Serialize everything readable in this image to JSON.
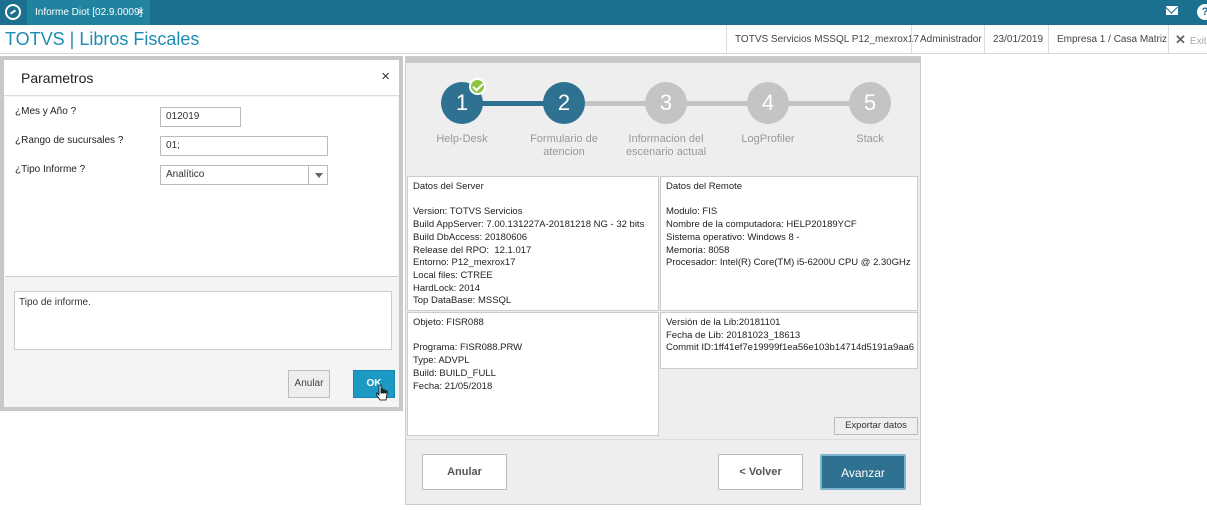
{
  "topbar": {
    "tab_label": "Informe Diot [02.9.0009]",
    "tab_close": "×",
    "icons": [
      "logo-icon",
      "mail-icon",
      "help-icon"
    ]
  },
  "header": {
    "title": "TOTVS | Libros Fiscales",
    "environment": "TOTVS Servicios MSSQL P12_mexrox17",
    "user": "Administrador",
    "date": "23/01/2019",
    "company": "Empresa 1 / Casa Matriz",
    "exit_label": "Exit"
  },
  "dialog": {
    "title": "Parametros",
    "close": "×",
    "fields": [
      {
        "label": "¿Mes y Año ?",
        "value": "012019"
      },
      {
        "label": "¿Rango de sucursales ?",
        "value": "01;"
      },
      {
        "label": "¿Tipo Informe ?",
        "value": "Analítico"
      }
    ],
    "help_text": "Tipo de informe.",
    "cancel_label": "Anular",
    "ok_label": "OK"
  },
  "wizard": {
    "steps": [
      {
        "number": "1",
        "label": "Help-Desk",
        "state": "complete"
      },
      {
        "number": "2",
        "label": "Formulario de atencion",
        "state": "active"
      },
      {
        "number": "3",
        "label": "Informacion del escenario actual",
        "state": "pending"
      },
      {
        "number": "4",
        "label": "LogProfiler",
        "state": "pending"
      },
      {
        "number": "5",
        "label": "Stack",
        "state": "pending"
      }
    ],
    "server_panel": "Datos del Server\n\nVersion: TOTVS Servicios\nBuild AppServer: 7.00.131227A-20181218 NG - 32 bits\nBuild DbAccess: 20180606\nRelease del RPO:  12.1.017\nEntorno: P12_mexrox17\nLocal files: CTREE\nHardLock: 2014\nTop DataBase: MSSQL",
    "remote_panel": "Datos del Remote\n\nModulo: FIS\nNombre de la computadora: HELP20189YCF\nSistema operativo: Windows 8 -\nMemoria: 8058\nProcesador: Intel(R) Core(TM) i5-6200U CPU @ 2.30GHz",
    "object_panel": "Objeto: FISR088\n\nPrograma: FISR088.PRW\nType: ADVPL\nBuild: BUILD_FULL\nFecha: 21/05/2018",
    "lib_panel": "Versión de la Lib:20181101\nFecha de Lib: 20181023_18613\nCommit ID:1ff41ef7e19999f1ea56e103b14714d5191a9aa6",
    "export_label": "Exportar datos",
    "cancel_label": "Anular",
    "back_label": "< Volver",
    "next_label": "Avanzar"
  },
  "colors": {
    "topbar": "#1b6f8f",
    "title": "#1d8cb3",
    "step_active": "#2e7191",
    "step_pending": "#c4c4c4",
    "check": "#8cc43f",
    "ok_button": "#1d9ac3"
  }
}
